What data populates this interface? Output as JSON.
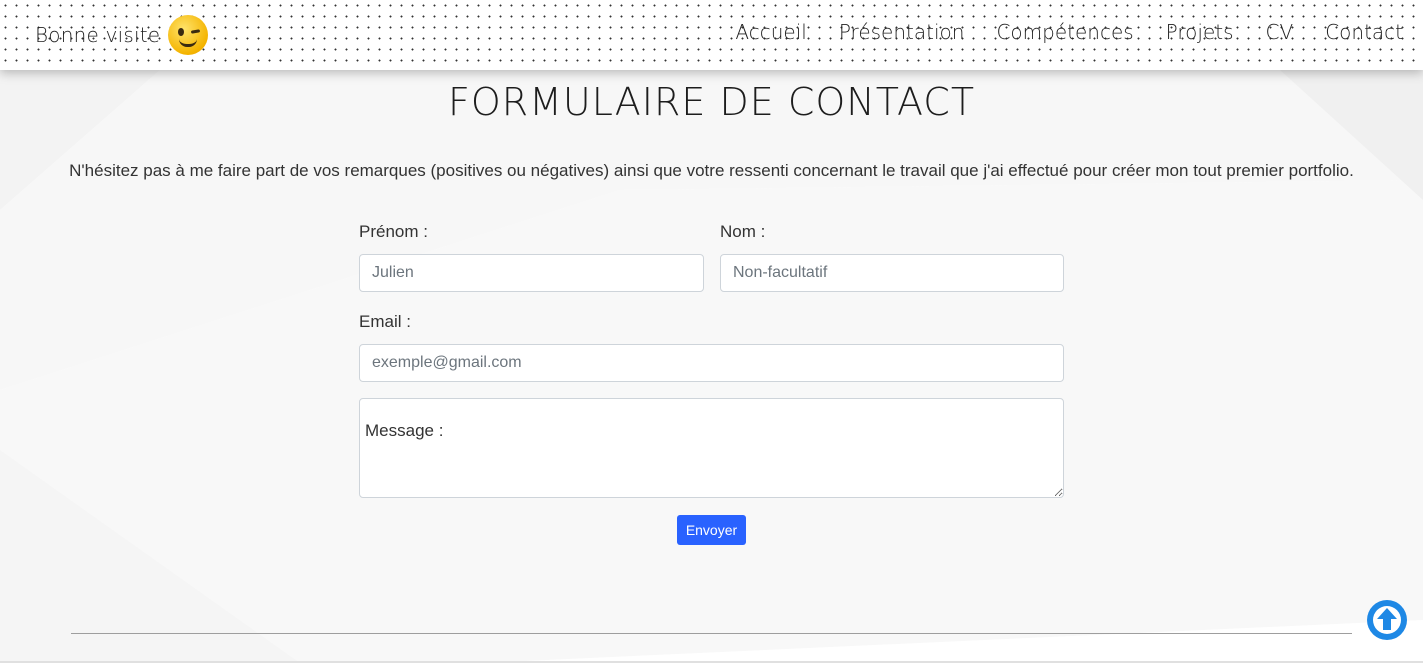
{
  "header": {
    "brand_text": "Bonne visite",
    "brand_emoji_icon": "winking-face-icon",
    "nav": [
      "Accueil",
      "Présentation",
      "Compétences",
      "Projets",
      "CV",
      "Contact"
    ]
  },
  "main": {
    "title": "FORMULAIRE DE CONTACT",
    "intro": "N'hésitez pas à me faire part de vos remarques (positives ou négatives) ainsi que votre ressenti concernant le travail que j'ai effectué pour créer mon tout premier portfolio.",
    "form": {
      "first_name_label": "Prénom :",
      "first_name_placeholder": "Julien",
      "last_name_label": "Nom :",
      "last_name_placeholder": "Non-facultatif",
      "email_label": "Email :",
      "email_placeholder": "exemple@gmail.com",
      "message_placeholder": "Message :",
      "submit_label": "Envoyer"
    }
  },
  "colors": {
    "accent": "#2962ff",
    "scroll_button": "#1e88e5"
  },
  "icons": {
    "scroll_top": "arrow-up-circle-icon"
  }
}
